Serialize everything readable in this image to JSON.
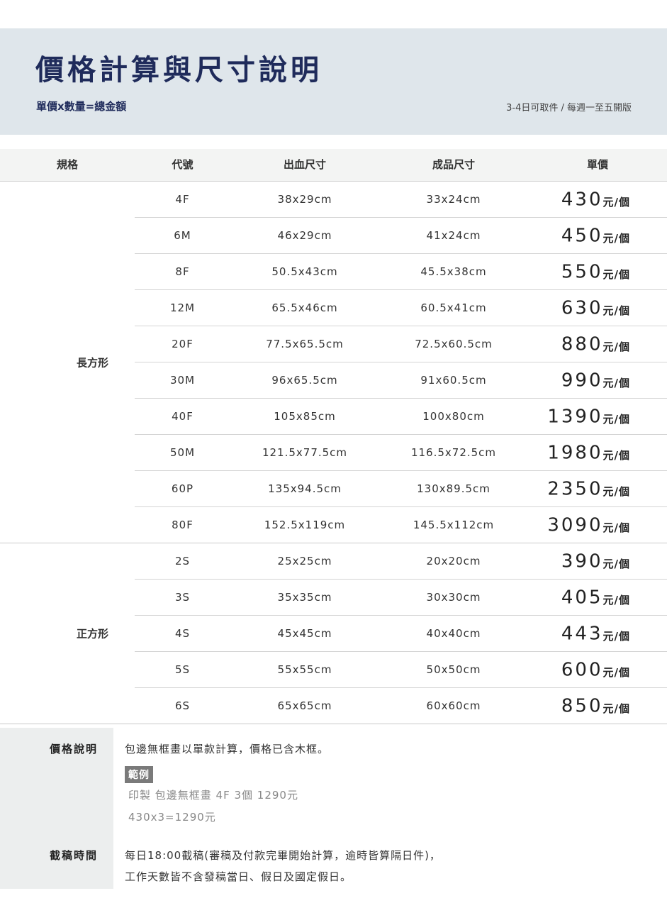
{
  "header": {
    "title": "價格計算與尺寸說明",
    "subtitle": "單價x數量=總金額",
    "schedule": "3-4日可取件 / 每週一至五開版"
  },
  "table": {
    "columns": [
      "規格",
      "代號",
      "出血尺寸",
      "成品尺寸",
      "單價"
    ],
    "price_unit": "元/個",
    "groups": [
      {
        "label": "長方形",
        "rows": [
          {
            "code": "4F",
            "bleed": "38x29cm",
            "final": "33x24cm",
            "price": "430"
          },
          {
            "code": "6M",
            "bleed": "46x29cm",
            "final": "41x24cm",
            "price": "450"
          },
          {
            "code": "8F",
            "bleed": "50.5x43cm",
            "final": "45.5x38cm",
            "price": "550"
          },
          {
            "code": "12M",
            "bleed": "65.5x46cm",
            "final": "60.5x41cm",
            "price": "630"
          },
          {
            "code": "20F",
            "bleed": "77.5x65.5cm",
            "final": "72.5x60.5cm",
            "price": "880"
          },
          {
            "code": "30M",
            "bleed": "96x65.5cm",
            "final": "91x60.5cm",
            "price": "990"
          },
          {
            "code": "40F",
            "bleed": "105x85cm",
            "final": "100x80cm",
            "price": "1390"
          },
          {
            "code": "50M",
            "bleed": "121.5x77.5cm",
            "final": "116.5x72.5cm",
            "price": "1980"
          },
          {
            "code": "60P",
            "bleed": "135x94.5cm",
            "final": "130x89.5cm",
            "price": "2350"
          },
          {
            "code": "80F",
            "bleed": "152.5x119cm",
            "final": "145.5x112cm",
            "price": "3090"
          }
        ]
      },
      {
        "label": "正方形",
        "rows": [
          {
            "code": "2S",
            "bleed": "25x25cm",
            "final": "20x20cm",
            "price": "390"
          },
          {
            "code": "3S",
            "bleed": "35x35cm",
            "final": "30x30cm",
            "price": "405"
          },
          {
            "code": "4S",
            "bleed": "45x45cm",
            "final": "40x40cm",
            "price": "443"
          },
          {
            "code": "5S",
            "bleed": "55x55cm",
            "final": "50x50cm",
            "price": "600"
          },
          {
            "code": "6S",
            "bleed": "65x65cm",
            "final": "60x60cm",
            "price": "850"
          }
        ]
      }
    ]
  },
  "notes": {
    "price_label": "價格說明",
    "price_text": "包邊無框畫以單款計算，價格已含木框。",
    "example_tag": "範例",
    "example_line1": "印製 包邊無框畫 4F 3個 1290元",
    "example_line2": "430x3=1290元",
    "deadline_label": "截稿時間",
    "deadline_line1": "每日18:00截稿(審稿及付款完畢開始計算，逾時皆算隔日件)，",
    "deadline_line2": "工作天數皆不含發稿當日、假日及國定假日。"
  }
}
